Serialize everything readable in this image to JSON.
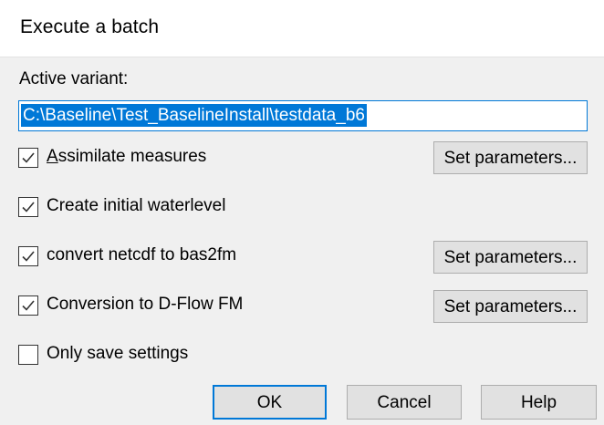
{
  "dialog": {
    "title": "Execute a batch",
    "active_variant_label": "Active variant:",
    "active_variant_value": "C:\\Baseline\\Test_BaselineInstall\\testdata_b6"
  },
  "options": [
    {
      "mnemonic": "A",
      "label_rest": "ssimilate measures",
      "checked": true,
      "button": "Set parameters..."
    },
    {
      "label": "Create initial waterlevel",
      "checked": true
    },
    {
      "label": "convert netcdf to bas2fm",
      "checked": true,
      "button": "Set parameters..."
    },
    {
      "label": "Conversion to D-Flow FM",
      "checked": true,
      "button": "Set parameters..."
    },
    {
      "label": "Only save settings",
      "checked": false
    }
  ],
  "buttons": {
    "ok": "OK",
    "cancel": "Cancel",
    "help": "Help"
  },
  "colors": {
    "accent": "#0078d7",
    "dialog_bg": "#f0f0f0",
    "button_bg": "#e1e1e1"
  }
}
